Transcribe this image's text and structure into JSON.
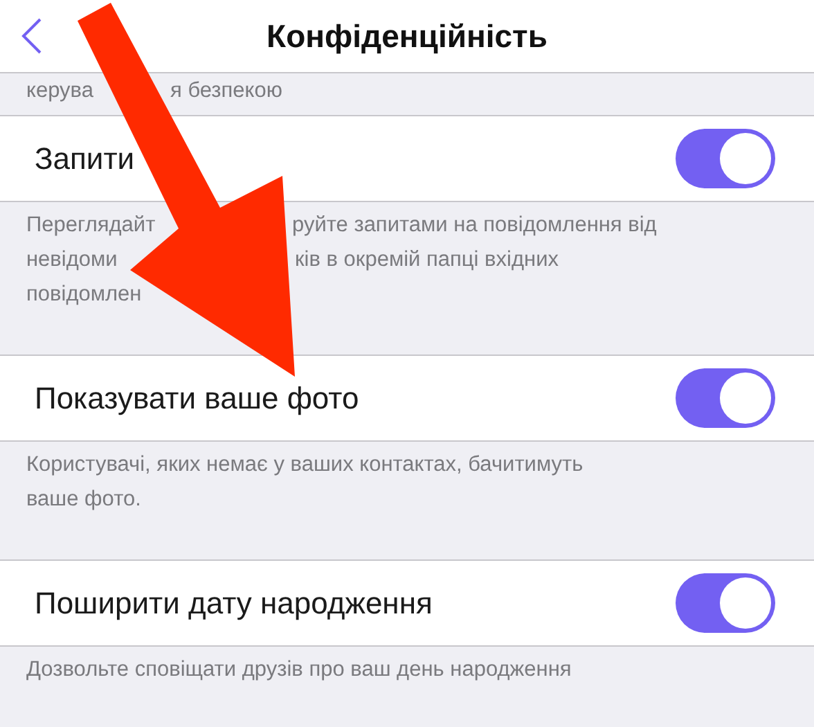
{
  "nav": {
    "title": "Конфіденційність"
  },
  "top_note": [
    [
      "керува",
      "я безпекою"
    ]
  ],
  "rows": [
    {
      "label": "Запити",
      "on": true,
      "note": [
        [
          "Переглядайт",
          "руйте запитами на повідомлення від"
        ],
        [
          "невідоми",
          "ків в окремій папці вхідних"
        ],
        [
          "повідомлен"
        ]
      ]
    },
    {
      "label": "Показувати ваше фото",
      "on": true,
      "note": [
        [
          "Користувачі, яких немає у ваших контактах, бачитимуть"
        ],
        [
          "ваше фото."
        ]
      ]
    },
    {
      "label": "Поширити дату народження",
      "on": true,
      "note": [
        [
          "Дозвольте сповіщати друзів про ваш день народження"
        ]
      ]
    }
  ]
}
